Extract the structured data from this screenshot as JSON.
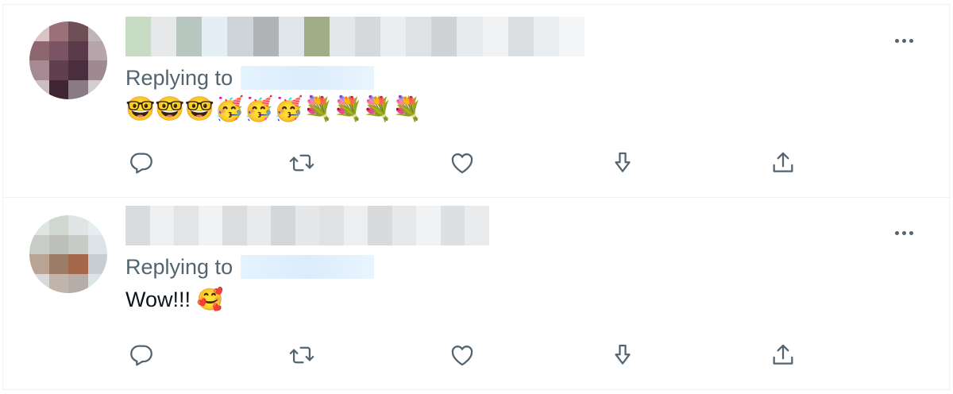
{
  "tweets": [
    {
      "replying_prefix": "Replying to",
      "text": "🤓🤓🤓🥳🥳🥳💐💐💐💐",
      "avatar_colors": [
        "#d8c4c4",
        "#9b7076",
        "#6e4f58",
        "#c0b6ba",
        "#8d6670",
        "#7a5462",
        "#5a3a48",
        "#b6a5ab",
        "#a78992",
        "#60404d",
        "#4b2e3d",
        "#a08a92",
        "#c9bfc2",
        "#3f2433",
        "#8a7a83",
        "#d3cdd0"
      ],
      "name_blur_colors": [
        "#c7dcc3",
        "#e6e8ea",
        "#b7c7bf",
        "#e3eef5",
        "#cdd5d9",
        "#b0b4b7",
        "#dfe6ea",
        "#9fae87",
        "#e4e7e9",
        "#d5d9dc",
        "#ebeef0",
        "#dfe2e4",
        "#cfd3d6",
        "#e8ebed",
        "#f0f2f4",
        "#dcdfe1",
        "#eaeef0",
        "#f3f5f6"
      ],
      "actions": [
        "reply-icon",
        "retweet-icon",
        "like-icon",
        "download-icon",
        "share-icon"
      ]
    },
    {
      "replying_prefix": "Replying to",
      "text": "Wow!!! 🥰",
      "avatar_colors": [
        "#dfe6e0",
        "#cfd7cf",
        "#dfe5e5",
        "#e7eef1",
        "#c8ccc6",
        "#bdbfba",
        "#c7cbc8",
        "#dde3e6",
        "#b8a394",
        "#9c7d67",
        "#a4674a",
        "#c7cfd4",
        "#d7dad8",
        "#c0b4ab",
        "#b6ada6",
        "#dde4e8"
      ],
      "name_blur_colors": [
        "#d9dcde",
        "#eef0f1",
        "#e2e4e6",
        "#f0f2f3",
        "#dadcde",
        "#e8eaec",
        "#d4d7d9",
        "#e5e7e9",
        "#dfe1e3",
        "#eceef0",
        "#d8dadc",
        "#e6e8ea",
        "#f1f2f3",
        "#dde0e2",
        "#e9ebed"
      ],
      "actions": [
        "reply-icon",
        "retweet-icon",
        "like-icon",
        "download-icon",
        "share-icon"
      ]
    }
  ],
  "icon_color": "#536471",
  "more_icon": "more-dots-icon"
}
